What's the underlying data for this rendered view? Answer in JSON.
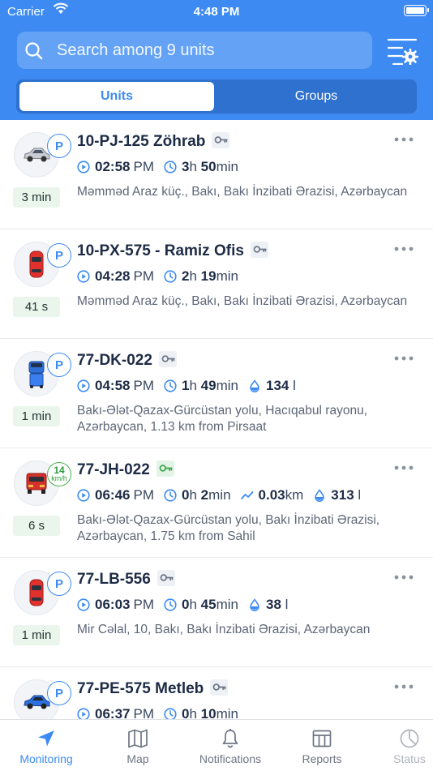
{
  "status_bar": {
    "carrier": "Carrier",
    "time": "4:48 PM"
  },
  "search": {
    "placeholder": "Search among 9 units"
  },
  "segments": {
    "units": "Units",
    "groups": "Groups",
    "selected": "Units"
  },
  "units": [
    {
      "name": "10-PJ-125 Zöhrab",
      "icon": "car-silver-icon",
      "badge": "P",
      "age": "3 min",
      "time": "02:58",
      "ampm": "PM",
      "dur_h": "3",
      "dur_h_unit": "h",
      "dur_m": "50",
      "dur_m_unit": "min",
      "address": "Məmməd Araz küç., Bakı, Bakı İnzibati Ərazisi, Azərbaycan"
    },
    {
      "name": "10-PX-575  - Ramiz Ofis",
      "icon": "car-red-icon",
      "badge": "P",
      "age": "41 s",
      "time": "04:28",
      "ampm": "PM",
      "dur_h": "2",
      "dur_h_unit": "h",
      "dur_m": "19",
      "dur_m_unit": "min",
      "address": "Məmməd Araz küç., Bakı, Bakı İnzibati Ərazisi, Azərbaycan"
    },
    {
      "name": "77-DK-022",
      "icon": "truck-blue-icon",
      "badge": "P",
      "age": "1 min",
      "time": "04:58",
      "ampm": "PM",
      "dur_h": "1",
      "dur_h_unit": "h",
      "dur_m": "49",
      "dur_m_unit": "min",
      "fuel": "134",
      "fuel_unit": "l",
      "address": "Bakı-Ələt-Qazax-Gürcüstan yolu, Hacıqabul rayonu, Azərbaycan, 1.13 km from Pirsaat"
    },
    {
      "name": "77-JH-022",
      "icon": "truck-red-icon",
      "speed": "14",
      "speed_unit": "km/h",
      "age": "6 s",
      "time": "06:46",
      "ampm": "PM",
      "dur_h": "0",
      "dur_h_unit": "h",
      "dur_m": "2",
      "dur_m_unit": "min",
      "distance": "0.03",
      "distance_unit": "km",
      "fuel": "313",
      "fuel_unit": "l",
      "address": "Bakı-Ələt-Qazax-Gürcüstan yolu, Bakı İnzibati Ərazisi, Azərbaycan, 1.75 km from Sahil"
    },
    {
      "name": "77-LB-556",
      "icon": "car-red-icon",
      "badge": "P",
      "age": "1 min",
      "time": "06:03",
      "ampm": "PM",
      "dur_h": "0",
      "dur_h_unit": "h",
      "dur_m": "45",
      "dur_m_unit": "min",
      "fuel": "38",
      "fuel_unit": "l",
      "address": "Mir Cəlal, 10, Bakı, Bakı İnzibati Ərazisi, Azərbaycan"
    },
    {
      "name": "77-PE-575 Metleb",
      "icon": "car-blue-icon",
      "badge": "P",
      "time": "06:37",
      "ampm": "PM",
      "dur_h": "0",
      "dur_h_unit": "h",
      "dur_m": "10",
      "dur_m_unit": "min"
    }
  ],
  "tabbar": {
    "monitoring": "Monitoring",
    "map": "Map",
    "notifications": "Notifications",
    "reports": "Reports",
    "status": "Status"
  },
  "colors": {
    "accent": "#3d8bf2",
    "header": "#3d8bf2",
    "age_bg": "#eaf6ec",
    "speed_badge": "#4cb050"
  }
}
